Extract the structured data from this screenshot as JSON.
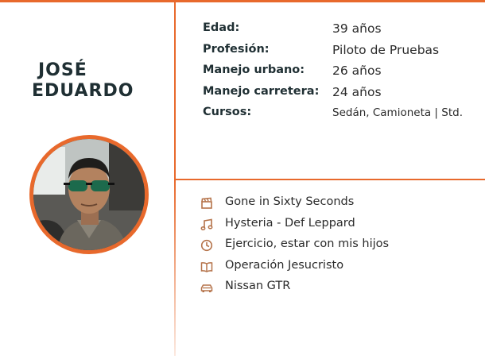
{
  "profile": {
    "first_name": "JOSÉ",
    "last_name": "EDUARDO",
    "avatar_icon": "person-photo"
  },
  "details": [
    {
      "label": "Edad:",
      "value": "39 años"
    },
    {
      "label": "Profesión:",
      "value": "Piloto de Pruebas"
    },
    {
      "label": "Manejo urbano:",
      "value": "26 años"
    },
    {
      "label": "Manejo carretera:",
      "value": "24 años"
    },
    {
      "label": "Cursos:",
      "value": "Sedán, Camioneta | Std."
    }
  ],
  "favorites": [
    {
      "icon": "clapperboard-icon",
      "text": "Gone in Sixty Seconds"
    },
    {
      "icon": "music-note-icon",
      "text": "Hysteria - Def Leppard"
    },
    {
      "icon": "clock-icon",
      "text": "Ejercicio, estar con mis hijos"
    },
    {
      "icon": "book-icon",
      "text": "Operación Jesucristo"
    },
    {
      "icon": "car-icon",
      "text": "Nissan GTR"
    }
  ],
  "colors": {
    "accent": "#e8692c",
    "heading": "#1f2f33",
    "icon": "#b5734a"
  }
}
